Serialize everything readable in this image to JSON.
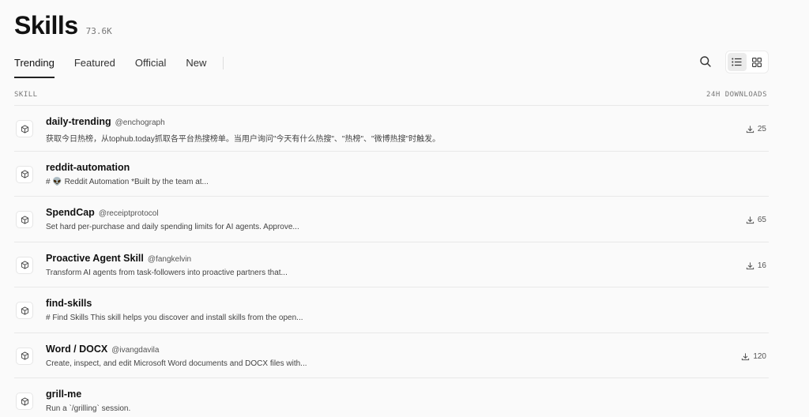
{
  "header": {
    "title": "Skills",
    "count": "73.6K"
  },
  "tabs": [
    {
      "label": "Trending",
      "active": true
    },
    {
      "label": "Featured",
      "active": false
    },
    {
      "label": "Official",
      "active": false
    },
    {
      "label": "New",
      "active": false
    }
  ],
  "toolbar": {
    "search_icon": "search-icon",
    "list_view_icon": "list-icon",
    "grid_view_icon": "grid-icon",
    "active_view": "list"
  },
  "table": {
    "col_skill": "SKILL",
    "col_downloads": "24H DOWNLOADS",
    "rows": [
      {
        "name": "daily-trending",
        "author": "@enchograph",
        "description": "获取今日热榜，从tophub.today抓取各平台热搜榜单。当用户询问\"今天有什么热搜\"、\"热榜\"、\"微博热搜\"时触发。",
        "downloads": "25"
      },
      {
        "name": "reddit-automation",
        "author": "",
        "description": "# 👽 Reddit Automation *Built by the team at...",
        "downloads": ""
      },
      {
        "name": "SpendCap",
        "author": "@receiptprotocol",
        "description": "Set hard per-purchase and daily spending limits for AI agents. Approve...",
        "downloads": "65"
      },
      {
        "name": "Proactive Agent Skill",
        "author": "@fangkelvin",
        "description": "Transform AI agents from task-followers into proactive partners that...",
        "downloads": "16"
      },
      {
        "name": "find-skills",
        "author": "",
        "description": "# Find Skills This skill helps you discover and install skills from the open...",
        "downloads": ""
      },
      {
        "name": "Word / DOCX",
        "author": "@ivangdavila",
        "description": "Create, inspect, and edit Microsoft Word documents and DOCX files with...",
        "downloads": "120"
      },
      {
        "name": "grill-me",
        "author": "",
        "description": "Run a `/grilling` session.",
        "downloads": ""
      }
    ]
  }
}
